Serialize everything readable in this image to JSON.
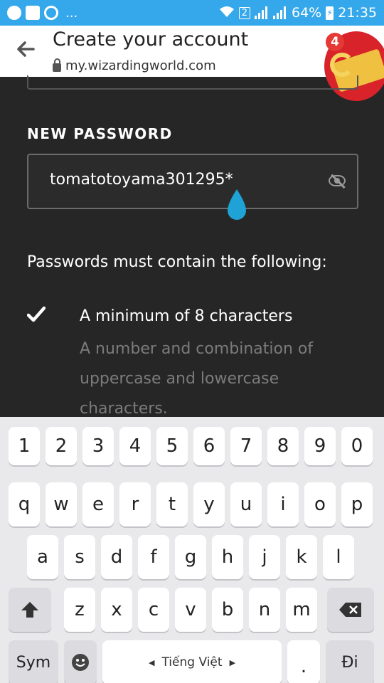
{
  "status_bar": {
    "notification_icons": [
      "messenger-icon",
      "gallery-icon",
      "screen-recorder-icon"
    ],
    "overflow": "...",
    "sim_badge": "2",
    "battery": "64%",
    "time": "21:35"
  },
  "browser": {
    "title": "Create your account",
    "url": "my.wizardingworld.com",
    "bubble_badge": "4"
  },
  "form": {
    "password_label": "NEW PASSWORD",
    "password_value": "tomatotoyama301295*",
    "requirements_title": "Passwords must contain the following:",
    "requirements": [
      {
        "text": "A minimum of 8 characters",
        "met": true
      },
      {
        "text": "A number and combination of uppercase and lowercase characters.",
        "met": false
      }
    ]
  },
  "keyboard": {
    "row_numbers": [
      "1",
      "2",
      "3",
      "4",
      "5",
      "6",
      "7",
      "8",
      "9",
      "0"
    ],
    "row_top": [
      "q",
      "w",
      "e",
      "r",
      "t",
      "y",
      "u",
      "i",
      "o",
      "p"
    ],
    "row_mid": [
      "a",
      "s",
      "d",
      "f",
      "g",
      "h",
      "j",
      "k",
      "l"
    ],
    "row_bottom": [
      "z",
      "x",
      "c",
      "v",
      "b",
      "n",
      "m"
    ],
    "sym_label": "Sym",
    "language_label": "Tiếng Việt",
    "period_label": ".",
    "action_label": "Đi"
  },
  "colors": {
    "status_bar": "#35a8ec",
    "page_bg": "#262626",
    "cursor_handle": "#1fa3d6",
    "hint_text": "#7b7b7b"
  }
}
